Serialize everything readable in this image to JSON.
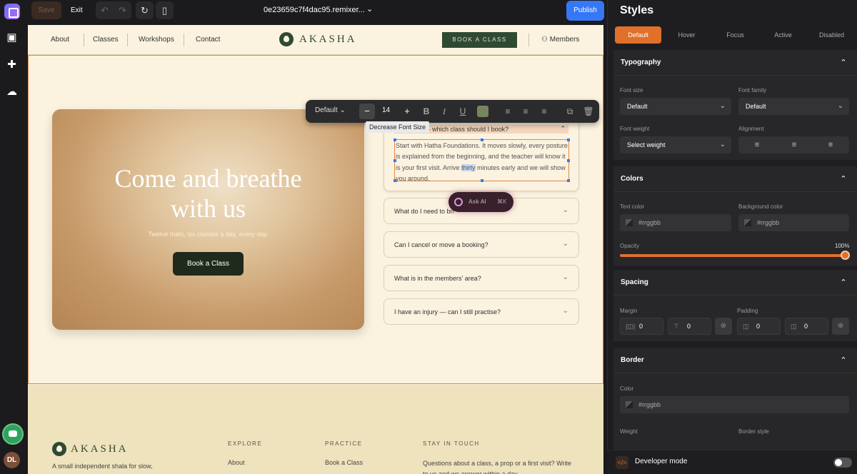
{
  "rail": {
    "avatar_initials": "DL"
  },
  "topbar": {
    "save_label": "Save",
    "exit_label": "Exit",
    "site_url": "0e23659c7f4dac95.remixer...",
    "publish_label": "Publish"
  },
  "site": {
    "nav": {
      "about": "About",
      "classes": "Classes",
      "workshops": "Workshops",
      "contact": "Contact",
      "brand": "AKASHA",
      "cta": "BOOK A CLASS",
      "members": "Members"
    },
    "hero": {
      "title_line1": "Come and breathe",
      "title_line2": "with us",
      "subtitle": "Twelve mats, six classes a day, every day.",
      "button": "Book a Class"
    },
    "faq_open": {
      "question": "one yoga — which class should I book?",
      "answer_pre": "Start with Hatha Foundations. It moves slowly, every posture is explained from the beginning, and the teacher will know it is your first visit. Arrive ",
      "answer_hl": "thirty",
      "answer_post": " minutes early and we will show you around."
    },
    "faqs": [
      "What do I need to bri",
      "Can I cancel or move a booking?",
      "What is in the members' area?",
      "I have an injury — can I still practise?"
    ],
    "ask_ai": {
      "label": "Ask AI",
      "shortcut": "⌘K"
    },
    "footer": {
      "brand": "AKASHA",
      "tagline": "A small independent shala for slow,",
      "explore_head": "EXPLORE",
      "explore_link": "About",
      "practice_head": "PRACTICE",
      "practice_link": "Book a Class",
      "touch_head": "STAY IN TOUCH",
      "touch_text": "Questions about a class, a prop or a first visit? Write to us and we answer within a day."
    }
  },
  "text_toolbar": {
    "style": "Default",
    "font_size": "14",
    "tooltip": "Decrease Font Size",
    "swatch_color": "#76855f"
  },
  "panel": {
    "title": "Styles",
    "states": [
      "Default",
      "Hover",
      "Focus",
      "Active",
      "Disabled"
    ],
    "typography": {
      "title": "Typography",
      "font_size_label": "Font size",
      "font_size_value": "Default",
      "font_family_label": "Font family",
      "font_family_value": "Default",
      "font_weight_label": "Font weight",
      "font_weight_value": "Select weight",
      "alignment_label": "Alignment"
    },
    "colors": {
      "title": "Colors",
      "text_color_label": "Text color",
      "text_color_ph": "#rrggbb",
      "bg_color_label": "Background color",
      "bg_color_ph": "#rrggbb",
      "opacity_label": "Opacity",
      "opacity_value": "100%"
    },
    "spacing": {
      "title": "Spacing",
      "margin_label": "Margin",
      "margin_v": "0",
      "margin_h": "0",
      "padding_label": "Padding",
      "padding_v": "0",
      "padding_h": "0"
    },
    "border": {
      "title": "Border",
      "color_label": "Color",
      "color_ph": "#rrggbb",
      "weight_label": "Weight",
      "style_label": "Border style"
    },
    "devmode_label": "Developer mode"
  },
  "colors": {
    "accent": "#e0702a",
    "publish": "#3478f6",
    "brand_green": "#2f4a33"
  }
}
